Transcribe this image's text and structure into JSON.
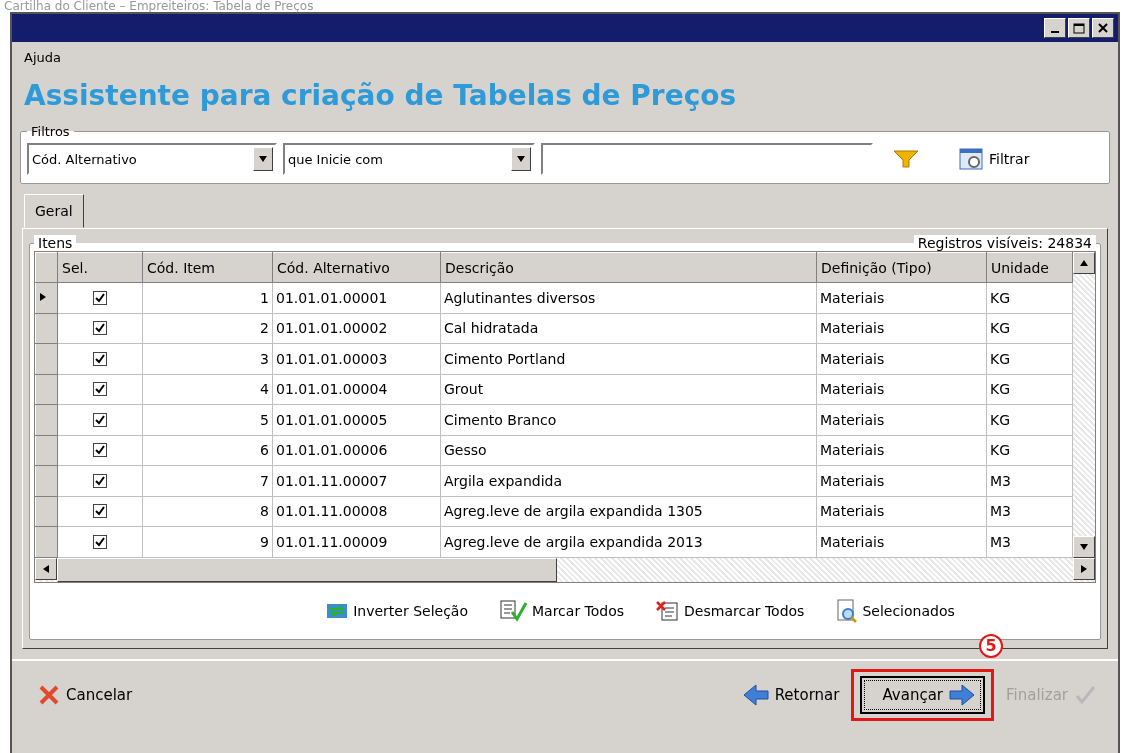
{
  "caption": "Cartilha do Cliente – Empreiteiros: Tabela de Preços",
  "menu": [
    {
      "label": "Ajuda"
    }
  ],
  "heading": "Assistente para criação de Tabelas de Preços",
  "filters": {
    "legend": "Filtros",
    "field": "Cód. Alternativo",
    "operator": "que Inicie com",
    "button": "Filtrar"
  },
  "tabs": [
    {
      "label": "Geral",
      "selected": true
    }
  ],
  "items": {
    "legend": "Itens",
    "visible_count": "Registros visíveis: 24834",
    "columns": [
      "",
      "Sel.",
      "Cód. Item",
      "Cód. Alternativo",
      "Descrição",
      "Definição (Tipo)",
      "Unidade"
    ],
    "rows": [
      {
        "current": true,
        "checked": true,
        "cells": [
          "",
          "",
          "1",
          "01.01.01.00001",
          "Aglutinantes diversos",
          "Materiais",
          "KG"
        ]
      },
      {
        "current": false,
        "checked": true,
        "cells": [
          "",
          "",
          "2",
          "01.01.01.00002",
          "Cal hidratada",
          "Materiais",
          "KG"
        ]
      },
      {
        "current": false,
        "checked": true,
        "cells": [
          "",
          "",
          "3",
          "01.01.01.00003",
          "Cimento Portland",
          "Materiais",
          "KG"
        ]
      },
      {
        "current": false,
        "checked": true,
        "cells": [
          "",
          "",
          "4",
          "01.01.01.00004",
          "Grout",
          "Materiais",
          "KG"
        ]
      },
      {
        "current": false,
        "checked": true,
        "cells": [
          "",
          "",
          "5",
          "01.01.01.00005",
          "Cimento Branco",
          "Materiais",
          "KG"
        ]
      },
      {
        "current": false,
        "checked": true,
        "cells": [
          "",
          "",
          "6",
          "01.01.01.00006",
          "Gesso",
          "Materiais",
          "KG"
        ]
      },
      {
        "current": false,
        "checked": true,
        "cells": [
          "",
          "",
          "7",
          "01.01.11.00007",
          "Argila expandida",
          "Materiais",
          "M3"
        ]
      },
      {
        "current": false,
        "checked": true,
        "cells": [
          "",
          "",
          "8",
          "01.01.11.00008",
          "Agreg.leve de argila expandida 1305",
          "Materiais",
          "M3"
        ]
      },
      {
        "current": false,
        "checked": true,
        "cells": [
          "",
          "",
          "9",
          "01.01.11.00009",
          "Agreg.leve de argila expandida 2013",
          "Materiais",
          "M3"
        ]
      }
    ]
  },
  "actions": [
    {
      "kind": "invert",
      "label": "Inverter Seleção"
    },
    {
      "kind": "check",
      "label": "Marcar Todos"
    },
    {
      "kind": "uncheck",
      "label": "Desmarcar Todos"
    },
    {
      "kind": "selected",
      "label": "Selecionados"
    }
  ],
  "footer": {
    "cancel": "Cancelar",
    "back": "Retornar",
    "next": {
      "label": "Avançar",
      "highlighted": true
    },
    "finish": {
      "label": "Finalizar",
      "disabled": true
    }
  },
  "step_marker": "5"
}
